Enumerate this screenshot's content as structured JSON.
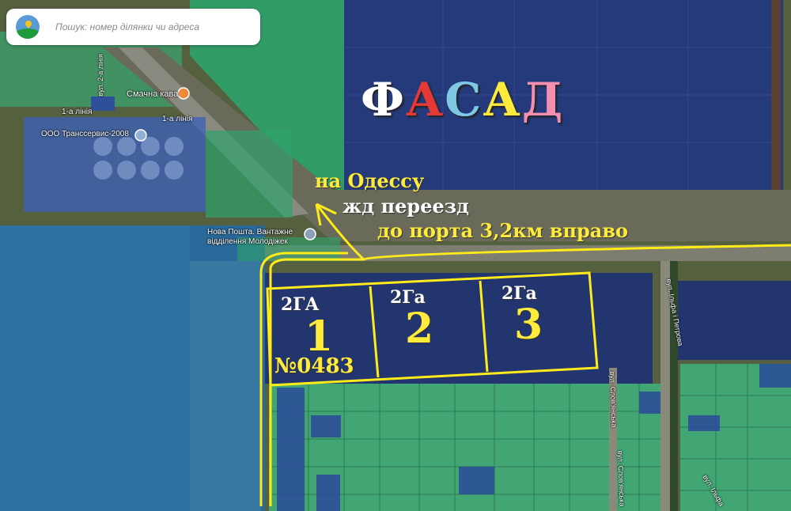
{
  "search": {
    "placeholder": "Пошук: номер ділянки чи адреса"
  },
  "map_labels": {
    "cafe": "Смачна кава",
    "line1_a": "1-а лінія",
    "line1_b": "1-а лінія",
    "company": "ООО Транссервис-2008",
    "nova_poshta": "Нова Пошта. Вантажне відділення Молодіжек",
    "street_2": "вул. 2-а лінія",
    "street_ilfa": "вул. Ільфа і Петрова",
    "street_slov_a": "вул. Слов'янська",
    "street_slov_b": "вул. Слов'янська",
    "street_ilfa_b": "вул. Ільфа"
  },
  "annotations": {
    "facade_letters": [
      {
        "char": "Ф",
        "color": "#ffffff"
      },
      {
        "char": "А",
        "color": "#e53935"
      },
      {
        "char": "С",
        "color": "#7ec8e3"
      },
      {
        "char": "А",
        "color": "#ffeb3b"
      },
      {
        "char": "Д",
        "color": "#f48fb1"
      }
    ],
    "to_odessa": "на Одессу",
    "rail_crossing": "жд переезд",
    "to_port": "до порта 3,2км вправо",
    "plots": [
      {
        "area": "2ГА",
        "number": "1",
        "cadastre": "№0483"
      },
      {
        "area": "2Га",
        "number": "2"
      },
      {
        "area": "2Га",
        "number": "3"
      }
    ]
  },
  "colors": {
    "accent": "#ffeb3b",
    "parcel_blue": "#2b3f7a",
    "parcel_green": "#3fae7a"
  }
}
